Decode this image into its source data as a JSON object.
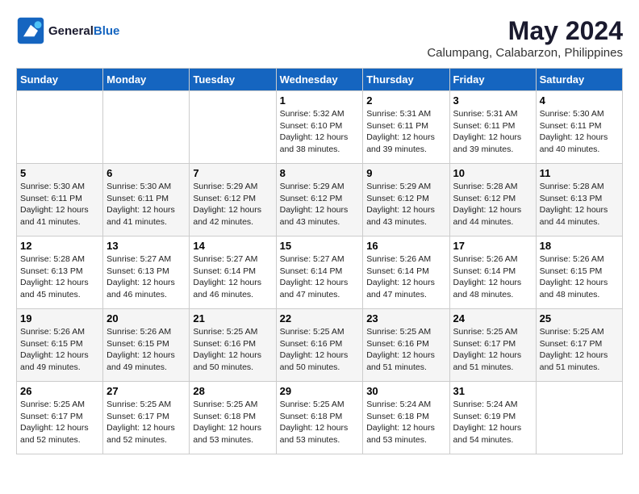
{
  "logo": {
    "text_general": "General",
    "text_blue": "Blue"
  },
  "title": {
    "month_year": "May 2024",
    "location": "Calumpang, Calabarzon, Philippines"
  },
  "headers": [
    "Sunday",
    "Monday",
    "Tuesday",
    "Wednesday",
    "Thursday",
    "Friday",
    "Saturday"
  ],
  "weeks": [
    [
      {
        "day": "",
        "sunrise": "",
        "sunset": "",
        "daylight": "",
        "empty": true
      },
      {
        "day": "",
        "sunrise": "",
        "sunset": "",
        "daylight": "",
        "empty": true
      },
      {
        "day": "",
        "sunrise": "",
        "sunset": "",
        "daylight": "",
        "empty": true
      },
      {
        "day": "1",
        "sunrise": "Sunrise: 5:32 AM",
        "sunset": "Sunset: 6:10 PM",
        "daylight": "Daylight: 12 hours and 38 minutes."
      },
      {
        "day": "2",
        "sunrise": "Sunrise: 5:31 AM",
        "sunset": "Sunset: 6:11 PM",
        "daylight": "Daylight: 12 hours and 39 minutes."
      },
      {
        "day": "3",
        "sunrise": "Sunrise: 5:31 AM",
        "sunset": "Sunset: 6:11 PM",
        "daylight": "Daylight: 12 hours and 39 minutes."
      },
      {
        "day": "4",
        "sunrise": "Sunrise: 5:30 AM",
        "sunset": "Sunset: 6:11 PM",
        "daylight": "Daylight: 12 hours and 40 minutes."
      }
    ],
    [
      {
        "day": "5",
        "sunrise": "Sunrise: 5:30 AM",
        "sunset": "Sunset: 6:11 PM",
        "daylight": "Daylight: 12 hours and 41 minutes."
      },
      {
        "day": "6",
        "sunrise": "Sunrise: 5:30 AM",
        "sunset": "Sunset: 6:11 PM",
        "daylight": "Daylight: 12 hours and 41 minutes."
      },
      {
        "day": "7",
        "sunrise": "Sunrise: 5:29 AM",
        "sunset": "Sunset: 6:12 PM",
        "daylight": "Daylight: 12 hours and 42 minutes."
      },
      {
        "day": "8",
        "sunrise": "Sunrise: 5:29 AM",
        "sunset": "Sunset: 6:12 PM",
        "daylight": "Daylight: 12 hours and 43 minutes."
      },
      {
        "day": "9",
        "sunrise": "Sunrise: 5:29 AM",
        "sunset": "Sunset: 6:12 PM",
        "daylight": "Daylight: 12 hours and 43 minutes."
      },
      {
        "day": "10",
        "sunrise": "Sunrise: 5:28 AM",
        "sunset": "Sunset: 6:12 PM",
        "daylight": "Daylight: 12 hours and 44 minutes."
      },
      {
        "day": "11",
        "sunrise": "Sunrise: 5:28 AM",
        "sunset": "Sunset: 6:13 PM",
        "daylight": "Daylight: 12 hours and 44 minutes."
      }
    ],
    [
      {
        "day": "12",
        "sunrise": "Sunrise: 5:28 AM",
        "sunset": "Sunset: 6:13 PM",
        "daylight": "Daylight: 12 hours and 45 minutes."
      },
      {
        "day": "13",
        "sunrise": "Sunrise: 5:27 AM",
        "sunset": "Sunset: 6:13 PM",
        "daylight": "Daylight: 12 hours and 46 minutes."
      },
      {
        "day": "14",
        "sunrise": "Sunrise: 5:27 AM",
        "sunset": "Sunset: 6:14 PM",
        "daylight": "Daylight: 12 hours and 46 minutes."
      },
      {
        "day": "15",
        "sunrise": "Sunrise: 5:27 AM",
        "sunset": "Sunset: 6:14 PM",
        "daylight": "Daylight: 12 hours and 47 minutes."
      },
      {
        "day": "16",
        "sunrise": "Sunrise: 5:26 AM",
        "sunset": "Sunset: 6:14 PM",
        "daylight": "Daylight: 12 hours and 47 minutes."
      },
      {
        "day": "17",
        "sunrise": "Sunrise: 5:26 AM",
        "sunset": "Sunset: 6:14 PM",
        "daylight": "Daylight: 12 hours and 48 minutes."
      },
      {
        "day": "18",
        "sunrise": "Sunrise: 5:26 AM",
        "sunset": "Sunset: 6:15 PM",
        "daylight": "Daylight: 12 hours and 48 minutes."
      }
    ],
    [
      {
        "day": "19",
        "sunrise": "Sunrise: 5:26 AM",
        "sunset": "Sunset: 6:15 PM",
        "daylight": "Daylight: 12 hours and 49 minutes."
      },
      {
        "day": "20",
        "sunrise": "Sunrise: 5:26 AM",
        "sunset": "Sunset: 6:15 PM",
        "daylight": "Daylight: 12 hours and 49 minutes."
      },
      {
        "day": "21",
        "sunrise": "Sunrise: 5:25 AM",
        "sunset": "Sunset: 6:16 PM",
        "daylight": "Daylight: 12 hours and 50 minutes."
      },
      {
        "day": "22",
        "sunrise": "Sunrise: 5:25 AM",
        "sunset": "Sunset: 6:16 PM",
        "daylight": "Daylight: 12 hours and 50 minutes."
      },
      {
        "day": "23",
        "sunrise": "Sunrise: 5:25 AM",
        "sunset": "Sunset: 6:16 PM",
        "daylight": "Daylight: 12 hours and 51 minutes."
      },
      {
        "day": "24",
        "sunrise": "Sunrise: 5:25 AM",
        "sunset": "Sunset: 6:17 PM",
        "daylight": "Daylight: 12 hours and 51 minutes."
      },
      {
        "day": "25",
        "sunrise": "Sunrise: 5:25 AM",
        "sunset": "Sunset: 6:17 PM",
        "daylight": "Daylight: 12 hours and 51 minutes."
      }
    ],
    [
      {
        "day": "26",
        "sunrise": "Sunrise: 5:25 AM",
        "sunset": "Sunset: 6:17 PM",
        "daylight": "Daylight: 12 hours and 52 minutes."
      },
      {
        "day": "27",
        "sunrise": "Sunrise: 5:25 AM",
        "sunset": "Sunset: 6:17 PM",
        "daylight": "Daylight: 12 hours and 52 minutes."
      },
      {
        "day": "28",
        "sunrise": "Sunrise: 5:25 AM",
        "sunset": "Sunset: 6:18 PM",
        "daylight": "Daylight: 12 hours and 53 minutes."
      },
      {
        "day": "29",
        "sunrise": "Sunrise: 5:25 AM",
        "sunset": "Sunset: 6:18 PM",
        "daylight": "Daylight: 12 hours and 53 minutes."
      },
      {
        "day": "30",
        "sunrise": "Sunrise: 5:24 AM",
        "sunset": "Sunset: 6:18 PM",
        "daylight": "Daylight: 12 hours and 53 minutes."
      },
      {
        "day": "31",
        "sunrise": "Sunrise: 5:24 AM",
        "sunset": "Sunset: 6:19 PM",
        "daylight": "Daylight: 12 hours and 54 minutes."
      },
      {
        "day": "",
        "sunrise": "",
        "sunset": "",
        "daylight": "",
        "empty": true
      }
    ]
  ]
}
